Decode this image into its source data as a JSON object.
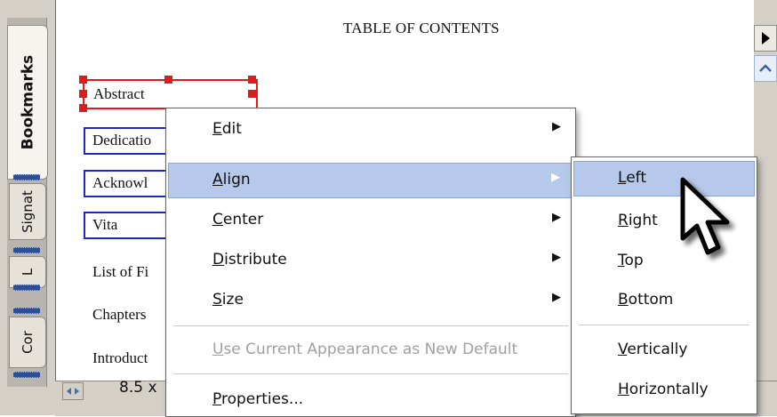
{
  "window": {
    "page_size": "8.5 x"
  },
  "nav_tabs": [
    {
      "label": "Bookmarks",
      "active": true
    },
    {
      "label": "Signat",
      "active": false
    },
    {
      "label": "L",
      "active": false
    },
    {
      "label": "Cor",
      "active": false
    }
  ],
  "document": {
    "title": "TABLE OF CONTENTS",
    "fields": [
      {
        "text": "Abstract",
        "selected": true
      },
      {
        "text": "Dedicatio"
      },
      {
        "text": "Acknowl"
      },
      {
        "text": "Vita"
      }
    ],
    "entries": [
      "List of Fi",
      "Chapters",
      "Introduct"
    ]
  },
  "context_menu": {
    "items": [
      {
        "pre": "",
        "ul": "E",
        "post": "dit",
        "submenu": true
      },
      {
        "pre": "",
        "ul": "A",
        "post": "lign",
        "submenu": true,
        "highlighted": true
      },
      {
        "pre": "",
        "ul": "C",
        "post": "enter",
        "submenu": true
      },
      {
        "pre": "",
        "ul": "D",
        "post": "istribute",
        "submenu": true
      },
      {
        "pre": "",
        "ul": "S",
        "post": "ize",
        "submenu": true
      },
      {
        "pre": "",
        "ul": "U",
        "post": "se Current Appearance as New Default",
        "disabled": true
      },
      {
        "pre": "",
        "ul": "P",
        "post": "roperties...",
        "submenu": false
      }
    ]
  },
  "align_submenu": {
    "items": [
      {
        "pre": "",
        "ul": "L",
        "post": "eft",
        "highlighted": true
      },
      {
        "pre": "",
        "ul": "R",
        "post": "ight"
      },
      {
        "pre": "",
        "ul": "T",
        "post": "op"
      },
      {
        "pre": "",
        "ul": "B",
        "post": "ottom"
      },
      {
        "pre": "",
        "ul": "V",
        "post": "ertically"
      },
      {
        "pre": "",
        "ul": "H",
        "post": "orizontally"
      }
    ]
  },
  "icons": {
    "submenu_arrow": "triangle-right-icon",
    "cursor": "mouse-pointer-icon"
  },
  "colors": {
    "menu_highlight": "#b7c9ea",
    "field_border": "#1e28c8",
    "selection": "#e31a1a"
  }
}
